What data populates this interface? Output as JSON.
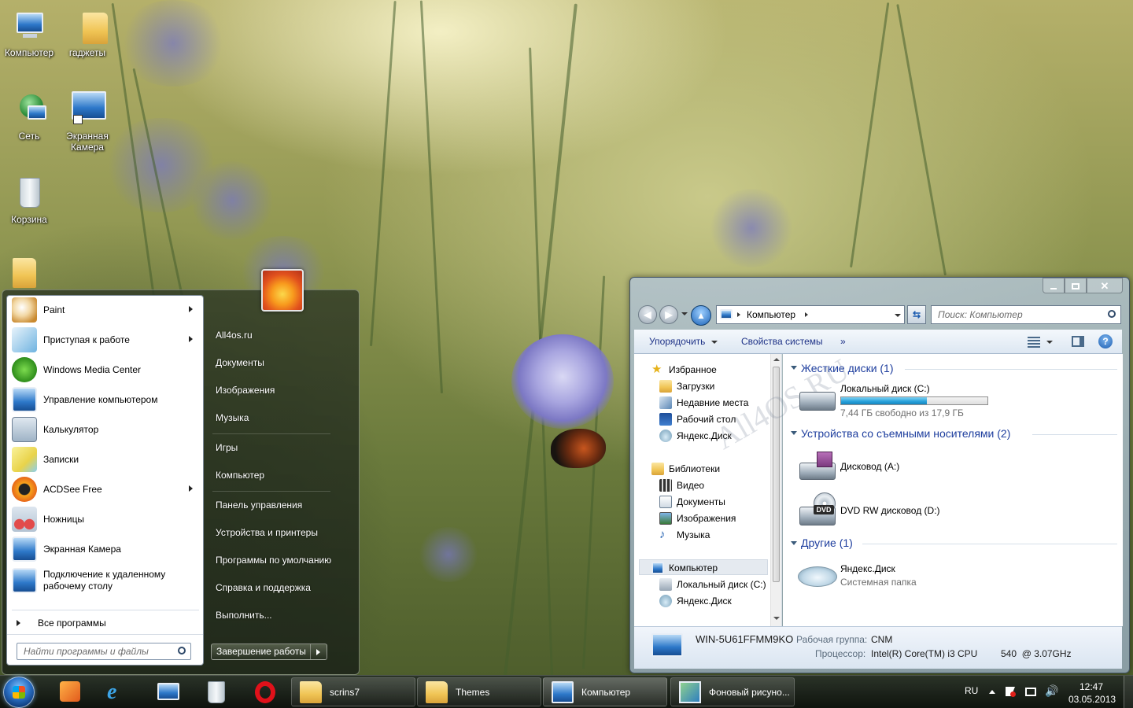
{
  "desktop": {
    "icons": [
      {
        "label": "Компьютер"
      },
      {
        "label": "гаджеты"
      },
      {
        "label": "Сеть"
      },
      {
        "label": "Экранная Камера"
      },
      {
        "label": "Корзина"
      }
    ]
  },
  "start_menu": {
    "programs": [
      {
        "label": "Paint",
        "has_submenu": true,
        "icon": "paint-icon"
      },
      {
        "label": "Приступая к работе",
        "has_submenu": true,
        "icon": "getting-started-icon"
      },
      {
        "label": "Windows Media Center",
        "has_submenu": false,
        "icon": "media-center-icon"
      },
      {
        "label": "Управление компьютером",
        "has_submenu": false,
        "icon": "computer-management-icon"
      },
      {
        "label": "Калькулятор",
        "has_submenu": false,
        "icon": "calculator-icon"
      },
      {
        "label": "Записки",
        "has_submenu": false,
        "icon": "sticky-notes-icon"
      },
      {
        "label": "ACDSee Free",
        "has_submenu": true,
        "icon": "acdsee-icon"
      },
      {
        "label": "Ножницы",
        "has_submenu": false,
        "icon": "snipping-tool-icon"
      },
      {
        "label": "Экранная Камера",
        "has_submenu": false,
        "icon": "screen-camera-icon"
      },
      {
        "label": "Подключение к удаленному рабочему столу",
        "has_submenu": false,
        "icon": "remote-desktop-icon"
      }
    ],
    "all_programs": "Все программы",
    "search_placeholder": "Найти программы и файлы",
    "right_items": [
      "All4os.ru",
      "Документы",
      "Изображения",
      "Музыка",
      "Игры",
      "Компьютер",
      "Панель управления",
      "Устройства и принтеры",
      "Программы по умолчанию",
      "Справка и поддержка",
      "Выполнить..."
    ],
    "shutdown_label": "Завершение работы"
  },
  "explorer": {
    "address": "Компьютер",
    "search_placeholder": "Поиск: Компьютер",
    "commands": {
      "organize": "Упорядочить",
      "system_properties": "Свойства системы",
      "more": "»"
    },
    "nav": {
      "favorites": "Избранное",
      "favorites_items": [
        "Загрузки",
        "Недавние места",
        "Рабочий стол",
        "Яндекс.Диск"
      ],
      "libraries": "Библиотеки",
      "libraries_items": [
        "Видео",
        "Документы",
        "Изображения",
        "Музыка"
      ],
      "computer": "Компьютер",
      "computer_items": [
        "Локальный диск (C:)",
        "Яндекс.Диск"
      ]
    },
    "groups": {
      "hard_disks": "Жесткие диски (1)",
      "removable": "Устройства со съемными носителями (2)",
      "other": "Другие (1)"
    },
    "drives": {
      "c": {
        "name": "Локальный диск (C:)",
        "free": "7,44 ГБ свободно из 17,9 ГБ",
        "used_fraction": 0.584
      },
      "a": {
        "name": "Дисковод (A:)"
      },
      "d": {
        "name": "DVD RW дисковод (D:)",
        "badge": "DVD"
      },
      "yandex": {
        "name": "Яндекс.Диск",
        "sub": "Системная папка"
      }
    },
    "watermark": "All4OS.RU",
    "details": {
      "computer_name": "WIN-5U61FFMM9KO",
      "workgroup_label": "Рабочая группа:",
      "workgroup": "CNM",
      "cpu_label": "Процессор:",
      "cpu": "Intel(R) Core(TM) i3 CPU",
      "cpu_model": "540  @ 3.07GHz"
    }
  },
  "taskbar": {
    "tasks": [
      "scrins7",
      "Themes",
      "Компьютер",
      "Фоновый рисуно..."
    ],
    "lang": "RU",
    "time": "12:47",
    "date": "03.05.2013"
  }
}
